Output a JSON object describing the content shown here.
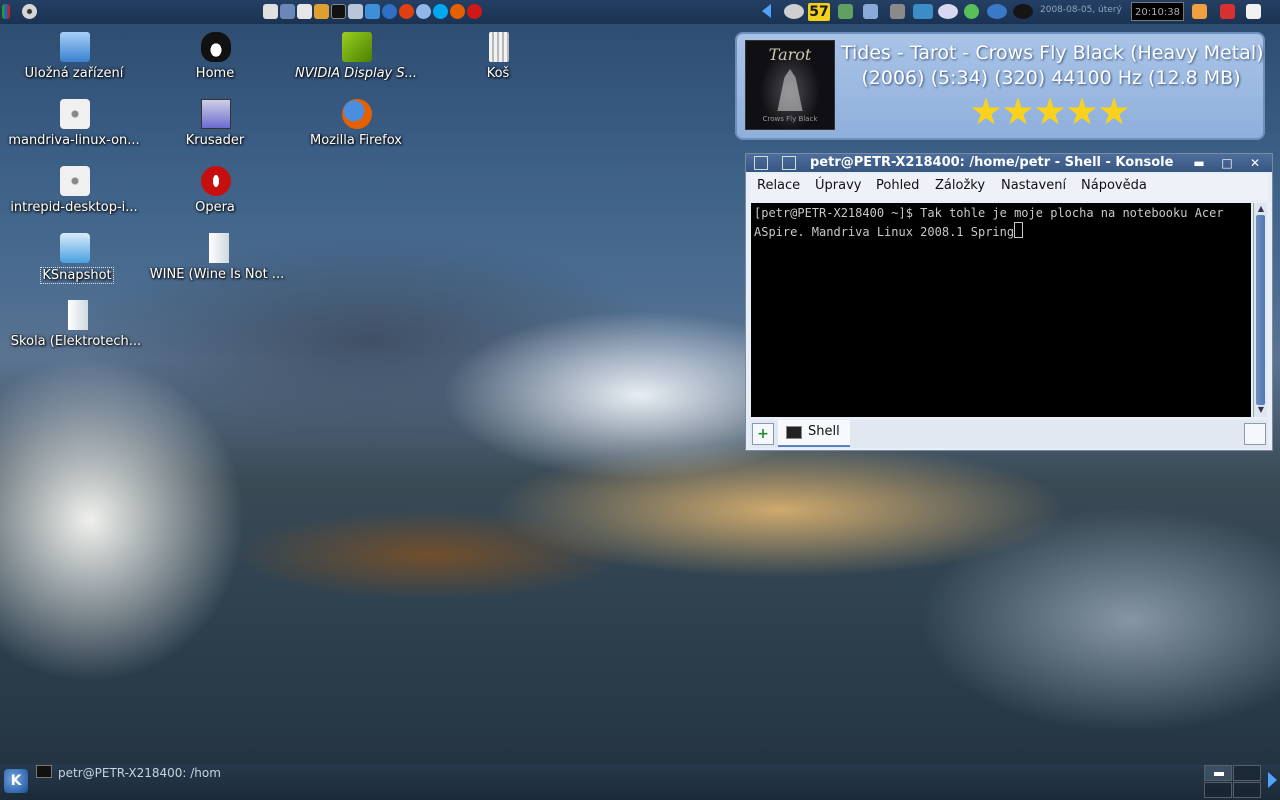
{
  "top_panel": {
    "left_icons": [
      "kmenu-icon",
      "disc-icon"
    ],
    "quicklaunch_icons": [
      "home-icon",
      "konqueror-icon",
      "mail-icon",
      "games-icon",
      "terminal-icon",
      "kontrol-icon",
      "network-icon",
      "firefox-icon",
      "opera-icon",
      "pidgin-icon",
      "skype-icon",
      "firefox-icon",
      "opera-icon"
    ],
    "tray_badge": "57",
    "tray_icons": [
      "network-icon",
      "bluetooth-icon",
      "display-icon",
      "chat-icon",
      "update-icon",
      "amarok-icon",
      "mixer-icon"
    ],
    "date": "2008-08-05, úterý",
    "clock": "20:10:38"
  },
  "desktop": {
    "icons": [
      {
        "label": "Úložná zařízení",
        "icon": "storage-devices-icon",
        "color": "#5aa0e0"
      },
      {
        "label": "mandriva-linux-on...",
        "icon": "cd-image-icon",
        "color": "#d8d8d8"
      },
      {
        "label": "intrepid-desktop-i...",
        "icon": "cd-image-icon",
        "color": "#d8d8d8"
      },
      {
        "label": "KSnapshot",
        "icon": "camera-icon",
        "color": "#5fb0e8"
      },
      {
        "label": "Škola (Elektrotech...",
        "icon": "document-icon",
        "color": "#f2f2f2"
      },
      {
        "label": "Home",
        "icon": "tux-icon",
        "color": "#f0c020"
      },
      {
        "label": "Krusader",
        "icon": "krusader-icon",
        "color": "#6b6bd0"
      },
      {
        "label": "Opera",
        "icon": "opera-icon",
        "color": "#d01818"
      },
      {
        "label": "WINE (Wine Is Not ...",
        "icon": "document-icon",
        "color": "#f2f2f2"
      },
      {
        "label": "NVIDIA Display S...",
        "icon": "nvidia-icon",
        "color": "#76b900"
      },
      {
        "label": "Mozilla Firefox",
        "icon": "firefox-icon",
        "color": "#e66000"
      },
      {
        "label": "Koš",
        "icon": "trash-icon",
        "color": "#dcdcdc"
      }
    ]
  },
  "now_playing": {
    "cover_title": "Tarot",
    "cover_subtitle": "Crows Fly Black",
    "line1": "Tides - Tarot - Crows Fly Black (Heavy Metal)",
    "line2": "(2006) (5:34) (320) 44100 Hz (12.8 MB)",
    "rating": 5
  },
  "konsole": {
    "title": "petr@PETR-X218400: /home/petr - Shell - Konsole",
    "menu": [
      "Relace",
      "Úpravy",
      "Pohled",
      "Záložky",
      "Nastavení",
      "Nápověda"
    ],
    "terminal_text": "[petr@PETR-X218400 ~]$ Tak tohle je moje plocha na notebooku Acer ASpire. Mandriva Linux 2008.1 Spring",
    "tab_label": "Shell"
  },
  "taskbar": {
    "task_label": "petr@PETR-X218400: /hom",
    "kmenu_label": "K"
  }
}
